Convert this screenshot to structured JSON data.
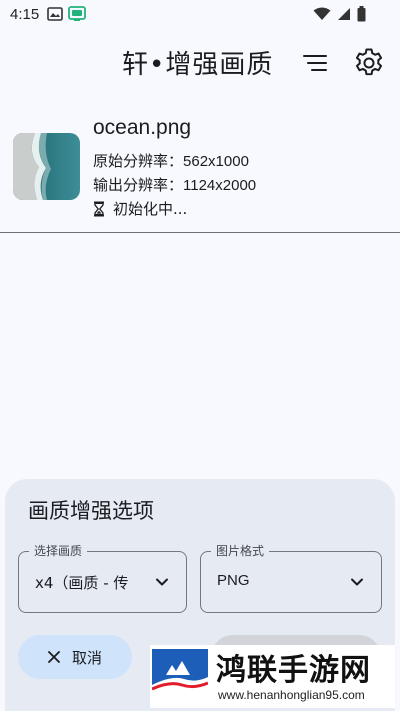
{
  "status_bar": {
    "time": "4:15"
  },
  "app_bar": {
    "title": "轩•增强画质"
  },
  "file": {
    "name": "ocean.png",
    "original_label": "原始分辨率：",
    "original_value": "562x1000",
    "output_label": "输出分辨率：",
    "output_value": "1124x2000",
    "status": "初始化中..."
  },
  "sheet": {
    "title": "画质增强选项",
    "quality_label": "选择画质",
    "quality_value": "x4（画质 - 传",
    "format_label": "图片格式",
    "format_value": "PNG",
    "cancel_label": "取消"
  },
  "watermark": {
    "text": "鸿联手游网",
    "url": "www.henanhonglian95.com"
  },
  "colors": {
    "background": "#f8f9fe",
    "sheet": "#e5eaf3",
    "cancel_button": "#cfe4fb",
    "start_button_disabled": "#d2d4da"
  }
}
